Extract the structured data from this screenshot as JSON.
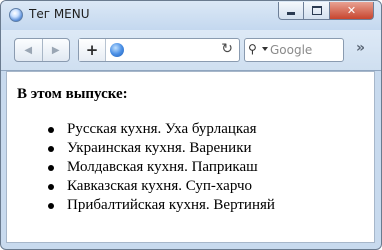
{
  "window": {
    "title": "Тег MENU",
    "controls": {
      "minimize_icon": "minimize-icon",
      "maximize_icon": "maximize-icon",
      "close_label": "✕"
    }
  },
  "toolbar": {
    "back_label": "◀",
    "forward_label": "▶",
    "new_tab_label": "+",
    "reload_label": "↻",
    "search": {
      "placeholder": "Google",
      "icon_label": "⚲"
    },
    "overflow_label": "»"
  },
  "content": {
    "heading": "В этом выпуске:",
    "items": [
      "Русская кухня. Уха бурлацкая",
      "Украинская кухня. Вареники",
      "Молдавская кухня. Паприкаш",
      "Кавказская кухня. Суп-харчо",
      "Прибалтийская кухня. Вертиняй"
    ]
  }
}
